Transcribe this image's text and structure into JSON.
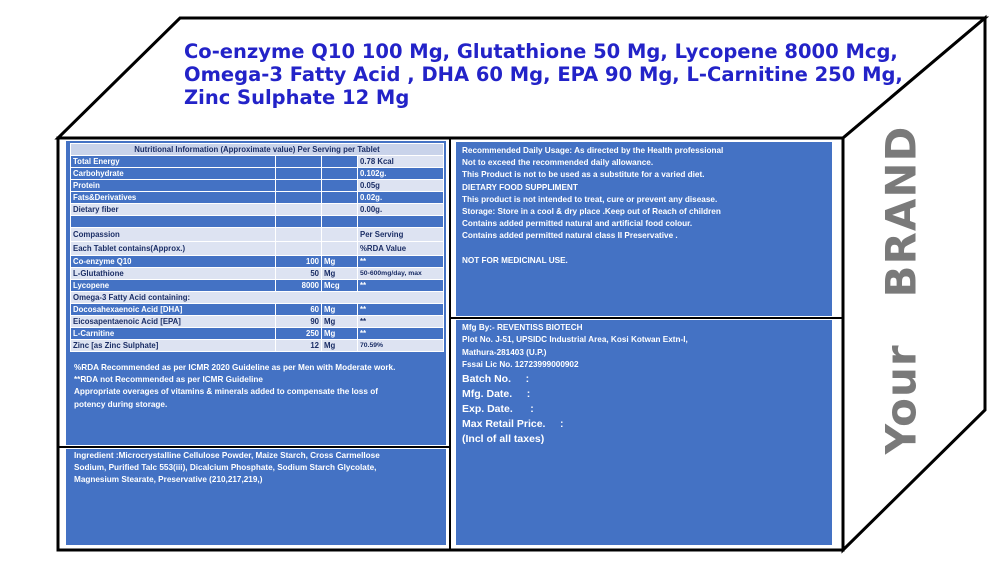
{
  "title_lines": [
    "Co-enzyme Q10 100 Mg, Glutathione 50 Mg, Lycopene 8000 Mcg,",
    "Omega-3 Fatty Acid , DHA 60 Mg, EPA 90 Mg, L-Carnitine 250 Mg,",
    "Zinc Sulphate 12 Mg"
  ],
  "brand": {
    "word1": "Your",
    "word2": "BRAND"
  },
  "nutrition": {
    "header": "Nutritional Information (Approximate value) Per Serving  per Tablet",
    "rows1": [
      {
        "name": "Total Energy",
        "value": "0.78 Kcal"
      },
      {
        "name": "Carbohydrate",
        "value": "0.102g."
      },
      {
        "name": "Protein",
        "value": "0.05g"
      },
      {
        "name": "Fats&Derivatives",
        "value": "0.02g."
      },
      {
        "name": "Dietary fiber",
        "value": "0.00g."
      }
    ],
    "compassion": "Compassion",
    "each_tablet": "Each Tablet contains(Approx.)",
    "per_serving": "Per Serving",
    "rda_value": "%RDA Value",
    "rows2": [
      {
        "name": "Co-enzyme Q10",
        "qty": "100",
        "unit": "Mg",
        "rda": "**"
      },
      {
        "name": "L-Glutathione",
        "qty": "50",
        "unit": "Mg",
        "rda": "50-600mg/day, max"
      },
      {
        "name": "Lycopene",
        "qty": "8000",
        "unit": "Mcg",
        "rda": "**"
      }
    ],
    "omega_header": "Omega-3 Fatty Acid containing:",
    "rows3": [
      {
        "name": "Docosahexaenoic Acid [DHA]",
        "qty": "60",
        "unit": "Mg",
        "rda": "**"
      },
      {
        "name": "Eicosapentaenoic Acid [EPA]",
        "qty": "90",
        "unit": "Mg",
        "rda": "**"
      },
      {
        "name": "L-Carnitine",
        "qty": "250",
        "unit": "Mg",
        "rda": "**"
      },
      {
        "name": "Zinc [as Zinc Sulphate]",
        "qty": "12",
        "unit": "Mg",
        "rda": "70.59%"
      }
    ]
  },
  "notes": [
    "%RDA Recommended as per ICMR 2020 Guideline as per Men with Moderate work.",
    "**RDA not Recommended as per ICMR Guideline",
    "Appropriate overages of vitamins & minerals added to compensate the loss of",
    "potency during storage."
  ],
  "ingredients": [
    "Ingredient :Microcrystalline Cellulose Powder, Maize Starch, Cross Carmellose",
    "Sodium, Purified Talc 553(iii), Dicalcium Phosphate, Sodium Starch Glycolate,",
    "Magnesium Stearate, Preservative (210,217,219,)"
  ],
  "usage": [
    "Recommended Daily Usage: As directed by the Health professional",
    "Not to exceed the recommended daily allowance.",
    "This Product is not to be used as a substitute for a varied diet.",
    "DIETARY FOOD SUPPLIMENT",
    "This product is not intended to treat, cure or prevent any disease.",
    "Storage: Store in a cool & dry place .Keep out of Reach of children",
    "Contains added permitted natural and artificial food colour.",
    "Contains added permitted natural class II Preservative ."
  ],
  "not_medicinal": "NOT FOR MEDICINAL USE.",
  "mfg": [
    "Mfg By:- REVENTISS BIOTECH",
    "Plot No. J-51, UPSIDC Industrial Area, Kosi Kotwan Extn-I,",
    "Mathura-281403 (U.P.)",
    "Fssai Lic No. 12723999000902"
  ],
  "batch": [
    "Batch No.     :",
    "Mfg. Date.     :",
    "Exp. Date.      :",
    "Max Retail Price.     :",
    "(Incl of all taxes)"
  ],
  "colors": {
    "panel": "#4472c4",
    "title": "#2323c8",
    "brand": "#7a7a7a"
  }
}
